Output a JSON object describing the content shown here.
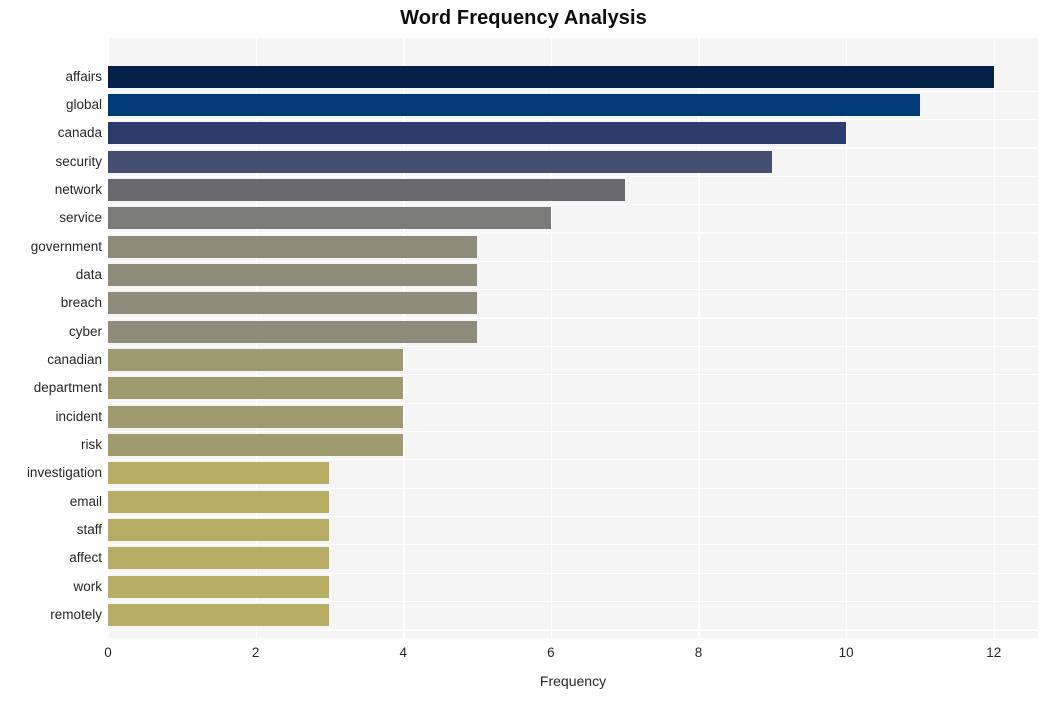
{
  "chart_data": {
    "type": "bar",
    "orientation": "horizontal",
    "title": "Word Frequency Analysis",
    "xlabel": "Frequency",
    "ylabel": "",
    "xlim": [
      0,
      12.6
    ],
    "xticks": [
      0,
      2,
      4,
      6,
      8,
      10,
      12
    ],
    "xticklabels": [
      "0",
      "2",
      "4",
      "6",
      "8",
      "10",
      "12"
    ],
    "grid": true,
    "legend": null,
    "categories": [
      "affairs",
      "global",
      "canada",
      "security",
      "network",
      "service",
      "government",
      "data",
      "breach",
      "cyber",
      "canadian",
      "department",
      "incident",
      "risk",
      "investigation",
      "email",
      "staff",
      "affect",
      "work",
      "remotely"
    ],
    "values": [
      12,
      11,
      10,
      9,
      7,
      6,
      5,
      5,
      5,
      5,
      4,
      4,
      4,
      4,
      3,
      3,
      3,
      3,
      3,
      3
    ],
    "colors": [
      "#04214a",
      "#003a77",
      "#2b3b6b",
      "#454f70",
      "#68686e",
      "#7b7b79",
      "#8e8b79",
      "#8e8b79",
      "#8f8c7b",
      "#908c7c",
      "#a09a6f",
      "#a09a6f",
      "#a09a6f",
      "#a19b70",
      "#b8ad67",
      "#b8ad67",
      "#b8ad67",
      "#b8ad67",
      "#b8ad67",
      "#b8ad67"
    ],
    "plot_background": "#f5f5f6",
    "grid_color": "#ffffff",
    "figure_background": "#ffffff"
  }
}
